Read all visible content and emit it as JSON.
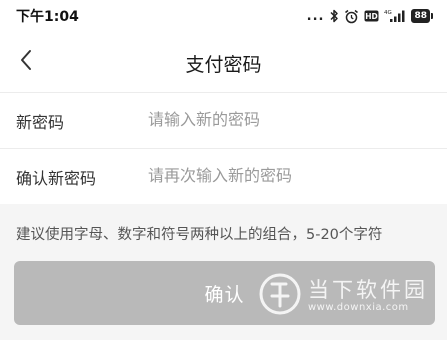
{
  "status_bar": {
    "time": "下午1:04",
    "dots": "...",
    "battery": "88",
    "network": "4G",
    "hd": "HD",
    "icons": [
      "bluetooth-icon",
      "alarm-icon",
      "hd-icon",
      "signal-icon",
      "battery-icon"
    ]
  },
  "nav": {
    "title": "支付密码",
    "back_icon": "chevron-left-icon"
  },
  "form": {
    "new_password": {
      "label": "新密码",
      "placeholder": "请输入新的密码",
      "value": ""
    },
    "confirm_password": {
      "label": "确认新密码",
      "placeholder": "请再次输入新的密码",
      "value": ""
    }
  },
  "hint": "建议使用字母、数字和符号两种以上的组合，5-20个字符",
  "confirm_button": {
    "label": "确认",
    "state": "disabled",
    "color": "#b9b9b9"
  },
  "watermark": {
    "title": "当下软件园",
    "url": "www.downxia.com"
  }
}
